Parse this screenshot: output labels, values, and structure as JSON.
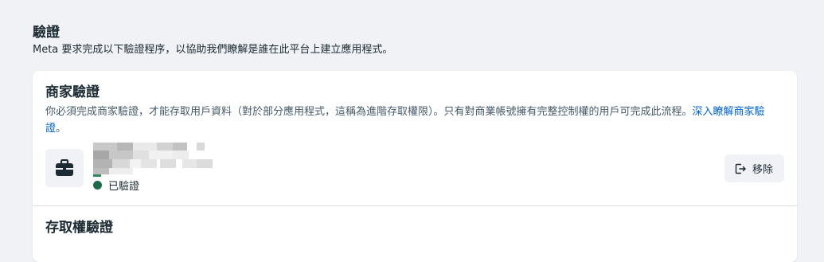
{
  "header": {
    "title": "驗證",
    "description": "Meta 要求完成以下驗證程序，以協助我們瞭解是誰在此平台上建立應用程式。"
  },
  "business_verification": {
    "title": "商家驗證",
    "description": "你必須完成商家驗證，才能存取用戶資料（對於部分應用程式，這稱為進階存取權限）。只有對商業帳號擁有完整控制權的用戶可完成此流程。",
    "learn_more_link": "深入瞭解商家驗證",
    "description_end": "。",
    "business_icon": "briefcase-icon",
    "status_label": "已驗證",
    "status_color": "#1b6b48",
    "remove_label": "移除",
    "remove_icon": "logout-icon"
  },
  "access_verification": {
    "title": "存取權驗證"
  },
  "colors": {
    "page_bg": "#f0f2f5",
    "card_bg": "#ffffff",
    "link": "#0064d1",
    "text": "#1c2b33"
  }
}
